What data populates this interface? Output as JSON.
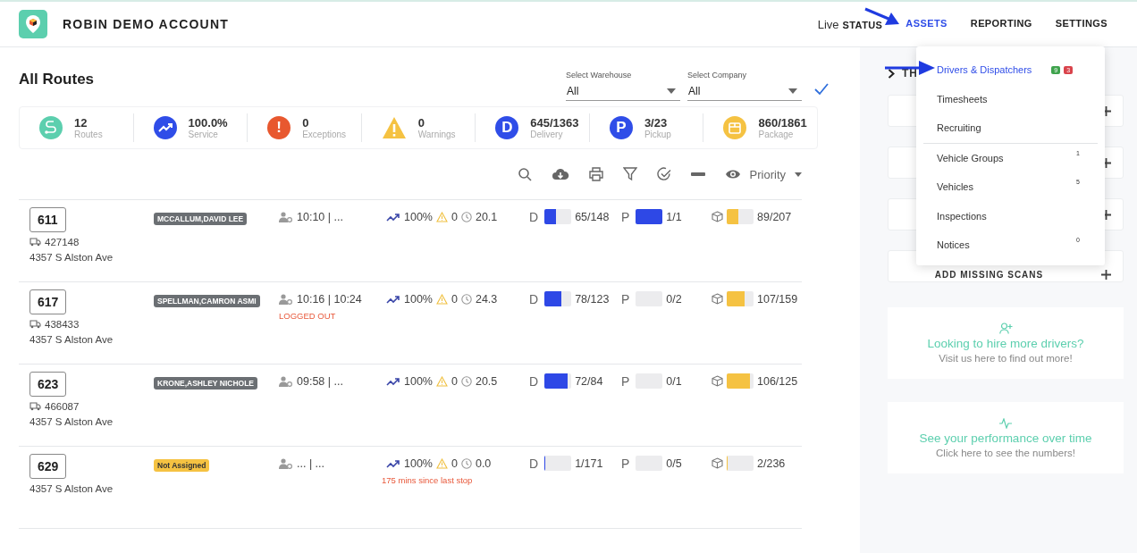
{
  "header": {
    "title": "ROBIN DEMO ACCOUNT",
    "nav": [
      {
        "prefix": "Live",
        "label": "STATUS",
        "selected": false
      },
      {
        "label": "ASSETS",
        "selected": true
      },
      {
        "label": "REPORTING",
        "selected": false
      },
      {
        "label": "SETTINGS",
        "selected": false
      }
    ]
  },
  "page_title": "All Routes",
  "filters": [
    {
      "label": "Select Warehouse",
      "value": "All"
    },
    {
      "label": "Select Company",
      "value": "All"
    }
  ],
  "stats": [
    {
      "kind": "route",
      "value": "12",
      "label": "Routes",
      "color": "#5ccfae"
    },
    {
      "kind": "trend",
      "value": "100.0%",
      "label": "Service",
      "color": "#2f4de8"
    },
    {
      "kind": "glyph",
      "glyph": "!",
      "value": "0",
      "label": "Exceptions",
      "color": "#e8582f"
    },
    {
      "kind": "warning",
      "value": "0",
      "label": "Warnings",
      "color": "#f5c242"
    },
    {
      "kind": "glyph",
      "glyph": "D",
      "value": "645/1363",
      "label": "Delivery",
      "color": "#2f4de8"
    },
    {
      "kind": "glyph",
      "glyph": "P",
      "value": "3/23",
      "label": "Pickup",
      "color": "#2f4de8"
    },
    {
      "kind": "package",
      "value": "860/1861",
      "label": "Package",
      "color": "#f5c242"
    }
  ],
  "toolbar": {
    "sort": "Priority"
  },
  "rows": [
    {
      "route": "611",
      "vehicle": "427148",
      "address": "4357 S Alston Ave",
      "driver": {
        "kind": "assigned",
        "name": "MCCALLUM,DAVID LEE"
      },
      "time": "10:10 | ...",
      "service": "100%",
      "warnings": "0",
      "duration": "20.1",
      "delivery": {
        "level": 0.44,
        "reading": "65/148"
      },
      "pickup": {
        "level": 1,
        "reading": "1/1"
      },
      "package": {
        "level": 0.43,
        "reading": "89/207"
      }
    },
    {
      "route": "617",
      "vehicle": "438433",
      "address": "4357 S Alston Ave",
      "driver": {
        "kind": "assigned",
        "name": "SPELLMAN,CAMRON ASMI"
      },
      "time": "10:16 | 10:24",
      "status": "LOGGED OUT",
      "service": "100%",
      "warnings": "0",
      "duration": "24.3",
      "delivery": {
        "level": 0.63,
        "reading": "78/123"
      },
      "pickup": {
        "level": 0,
        "reading": "0/2"
      },
      "package": {
        "level": 0.67,
        "reading": "107/159"
      }
    },
    {
      "route": "623",
      "vehicle": "466087",
      "address": "4357 S Alston Ave",
      "driver": {
        "kind": "assigned",
        "name": "KRONE,ASHLEY NICHOLE"
      },
      "time": "09:58 | ...",
      "service": "100%",
      "warnings": "0",
      "duration": "20.5",
      "delivery": {
        "level": 0.86,
        "reading": "72/84"
      },
      "pickup": {
        "level": 0,
        "reading": "0/1"
      },
      "package": {
        "level": 0.85,
        "reading": "106/125"
      }
    },
    {
      "route": "629",
      "address": "4357 S Alston Ave",
      "driver": {
        "kind": "unassigned",
        "name": "Not Assigned"
      },
      "time": "... | ...",
      "service": "100%",
      "warnings": "0",
      "duration": "0.0",
      "note": "175 mins since last stop",
      "delivery": {
        "level": 0.01,
        "reading": "1/171"
      },
      "pickup": {
        "level": 0,
        "reading": "0/5"
      },
      "package": {
        "level": 0.01,
        "reading": "2/236"
      }
    }
  ],
  "row_letters": [
    {
      "delivery": "D",
      "pickup": "P"
    },
    {
      "delivery": "D",
      "pickup": "P"
    },
    {
      "delivery": "D",
      "pickup": "P"
    },
    {
      "delivery": "D",
      "pickup": "P"
    }
  ],
  "sidebar": {
    "heading": "TH",
    "actions": [
      {
        "label": "ADD MISSING SCANS"
      }
    ],
    "promos": [
      {
        "kind": "hire",
        "title": "Looking to hire more drivers?",
        "subtitle": "Visit us here to find out more!"
      },
      {
        "kind": "performance",
        "title": "See your performance over time",
        "subtitle": "Click here to see the numbers!"
      }
    ]
  },
  "menu": [
    {
      "label": "Drivers & Dispatchers",
      "selected": true,
      "badges": [
        {
          "text": "9",
          "color": "#3fa34d"
        },
        {
          "text": "3",
          "color": "#d9434b"
        }
      ]
    },
    {
      "label": "Timesheets",
      "selected": false
    },
    {
      "label": "Recruiting",
      "selected": false
    },
    {
      "label": "Vehicle Groups",
      "selected": false,
      "divider_before": true,
      "count": "1"
    },
    {
      "label": "Vehicles",
      "selected": false,
      "count": "5"
    },
    {
      "label": "Inspections",
      "selected": false
    },
    {
      "label": "Notices",
      "selected": false,
      "count": "0"
    }
  ]
}
